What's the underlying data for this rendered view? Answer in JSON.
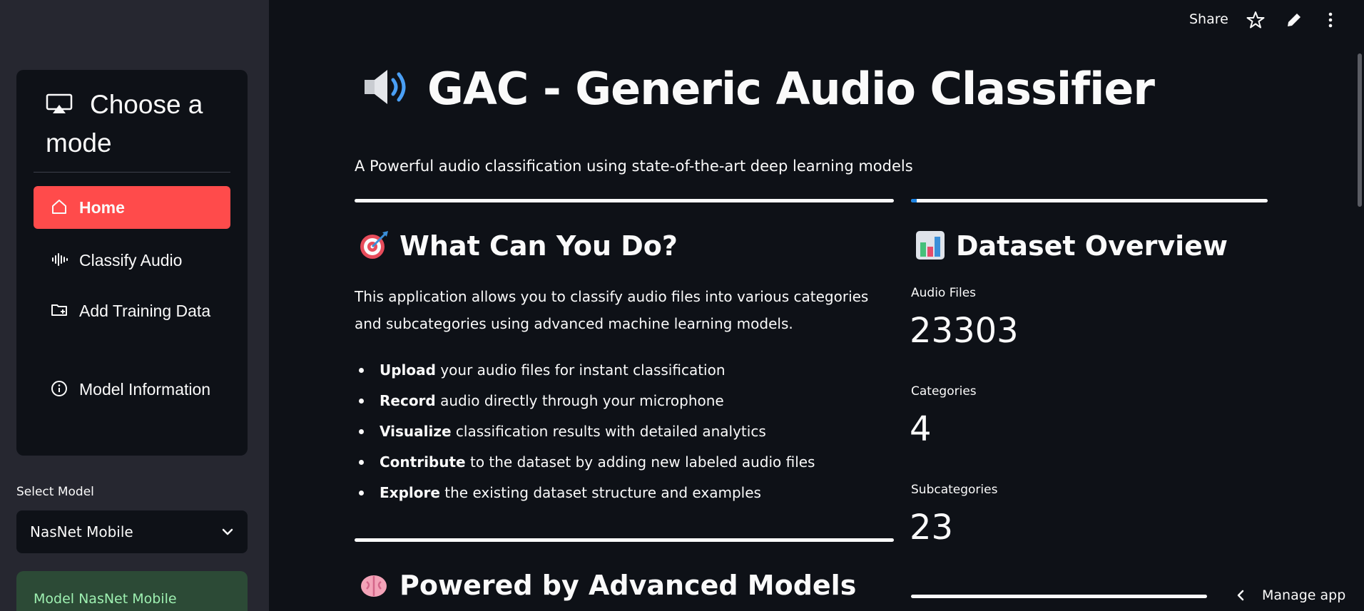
{
  "sidebar": {
    "menu_title": "Choose a mode",
    "nav_items": [
      {
        "label": "Home",
        "icon": "house-icon",
        "active": true
      },
      {
        "label": "Classify Audio",
        "icon": "audio-waveform-icon",
        "active": false
      },
      {
        "label": "Add Training Data",
        "icon": "folder-plus-icon",
        "active": false
      },
      {
        "label": "Model Information",
        "icon": "info-circle-icon",
        "active": false
      }
    ],
    "select_model": {
      "label": "Select Model",
      "value": "NasNet Mobile"
    },
    "model_card": "Model NasNet Mobile"
  },
  "toolbar": {
    "share": "Share",
    "icons": [
      "star-icon",
      "pencil-icon",
      "more-vertical-icon"
    ]
  },
  "main": {
    "title": "GAC - Generic Audio Classifier",
    "subtitle": "A Powerful audio classification using state-of-the-art deep learning models",
    "what_can_you_do": {
      "heading": "What Can You Do?",
      "intro": "This application allows you to classify audio files into various categories and subcategories using advanced machine learning models.",
      "bullets": [
        {
          "bold": "Upload",
          "rest": " your audio files for instant classification"
        },
        {
          "bold": "Record",
          "rest": " audio directly through your microphone"
        },
        {
          "bold": "Visualize",
          "rest": " classification results with detailed analytics"
        },
        {
          "bold": "Contribute",
          "rest": " to the dataset by adding new labeled audio files"
        },
        {
          "bold": "Explore",
          "rest": " the existing dataset structure and examples"
        }
      ]
    },
    "dataset_overview": {
      "heading": "Dataset Overview",
      "metrics": [
        {
          "label": "Audio Files",
          "value": "23303"
        },
        {
          "label": "Categories",
          "value": "4"
        },
        {
          "label": "Subcategories",
          "value": "23"
        }
      ]
    },
    "powered_heading": "Powered by Advanced Models"
  },
  "manage_app": "Manage app",
  "colors": {
    "accent": "#ff4b4b",
    "background": "#0e1117",
    "sidebar": "#262730",
    "success_bg": "#2c4a36",
    "success_text": "#9ef0b1"
  }
}
